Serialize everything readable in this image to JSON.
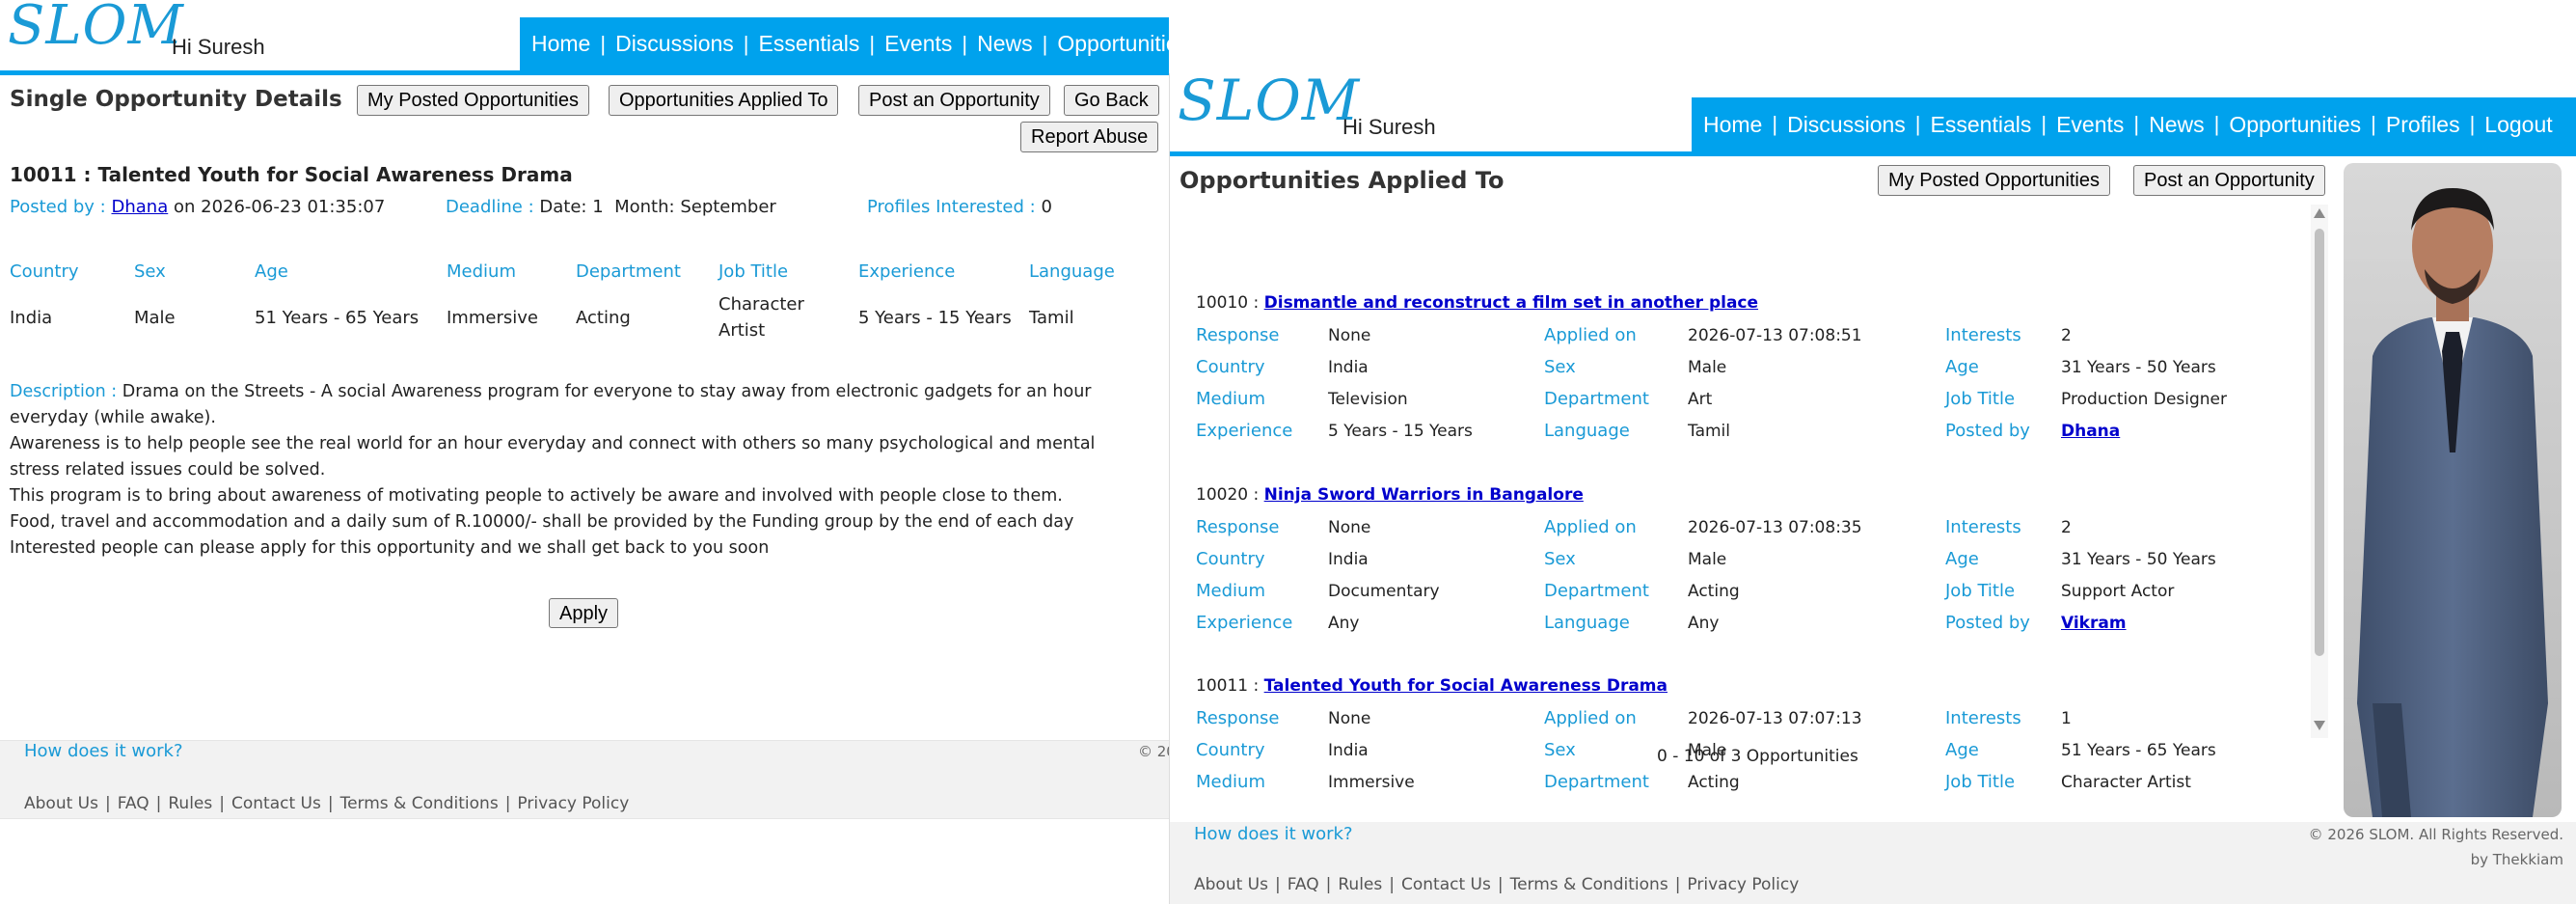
{
  "brand": {
    "logo": "SLOM",
    "greeting": "Hi Suresh",
    "accent": "#00a2ed",
    "label_color": "#1a9ad6"
  },
  "nav": [
    "Home",
    "Discussions",
    "Essentials",
    "Events",
    "News",
    "Opportunities",
    "Profiles",
    "Logout"
  ],
  "nav_sep": "|",
  "left": {
    "title": "Single Opportunity Details",
    "buttons": {
      "my_posted": "My Posted Opportunities",
      "applied_to": "Opportunities Applied To",
      "post": "Post an Opportunity",
      "go_back": "Go Back",
      "report": "Report Abuse"
    },
    "opp_title": "10011 : Talented Youth for Social Awareness Drama",
    "posted_by_label": "Posted by :",
    "posted_by": "Dhana",
    "posted_on": "on 2026-06-23 01:35:07",
    "deadline_label": "Deadline :",
    "deadline": "Date: 1  Month: September",
    "interested_label": "Profiles Interested :",
    "interested": "0",
    "headers": [
      "Country",
      "Sex",
      "Age",
      "Medium",
      "Department",
      "Job Title",
      "Experience",
      "Language"
    ],
    "values": [
      "India",
      "Male",
      "51 Years - 65 Years",
      "Immersive",
      "Acting",
      "Character\nArtist",
      "5 Years - 15 Years",
      "Tamil"
    ],
    "desc_label": "Description :",
    "desc_first": "Drama on the Streets - A social Awareness program for everyone to stay away from electronic gadgets for an hour everyday (while awake).",
    "desc_lines": [
      "Awareness is to help people see the real world for an hour everyday and connect with others so many psychological and mental stress related issues could be solved.",
      "This program is to bring about awareness of motivating people to actively be aware and involved with people close to them.",
      "Food, travel and accommodation and a daily sum of R.10000/- shall be provided by the Funding group by the end of each day",
      "Interested people can please apply for this opportunity and we shall get back to you soon"
    ],
    "apply": "Apply",
    "copyright_fragment": "© 20"
  },
  "right": {
    "title": "Opportunities Applied To",
    "buttons": {
      "my_posted": "My Posted Opportunities",
      "post": "Post an Opportunity"
    },
    "labels": {
      "response": "Response",
      "applied_on": "Applied on",
      "interests": "Interests",
      "country": "Country",
      "sex": "Sex",
      "age": "Age",
      "medium": "Medium",
      "department": "Department",
      "job_title": "Job Title",
      "experience": "Experience",
      "language": "Language",
      "posted_by": "Posted by"
    },
    "items": [
      {
        "id": "10010 :",
        "title": "Dismantle and reconstruct a film set in another place",
        "response": "None",
        "applied_on": "2026-07-13 07:08:51",
        "interests": "2",
        "country": "India",
        "sex": "Male",
        "age": "31 Years - 50 Years",
        "medium": "Television",
        "department": "Art",
        "job_title": "Production Designer",
        "experience": "5 Years - 15 Years",
        "language": "Tamil",
        "posted_by": "Dhana"
      },
      {
        "id": "10020 :",
        "title": "Ninja Sword Warriors in Bangalore",
        "response": "None",
        "applied_on": "2026-07-13 07:08:35",
        "interests": "2",
        "country": "India",
        "sex": "Male",
        "age": "31 Years - 50 Years",
        "medium": "Documentary",
        "department": "Acting",
        "job_title": "Support Actor",
        "experience": "Any",
        "language": "Any",
        "posted_by": "Vikram"
      },
      {
        "id": "10011 :",
        "title": "Talented Youth for Social Awareness Drama",
        "response": "None",
        "applied_on": "2026-07-13 07:07:13",
        "interests": "1",
        "country": "India",
        "sex": "Male",
        "age": "51 Years - 65 Years",
        "medium": "Immersive",
        "department": "Acting",
        "job_title": "Character Artist"
      }
    ],
    "pagination": "0 - 10 of 3 Opportunities",
    "copyright": "© 2026 SLOM. All Rights Reserved.",
    "by": "by Thekkiam"
  },
  "footer": {
    "how": "How does it work?",
    "links": [
      "About Us",
      "FAQ",
      "Rules",
      "Contact Us",
      "Terms & Conditions",
      "Privacy Policy"
    ]
  }
}
